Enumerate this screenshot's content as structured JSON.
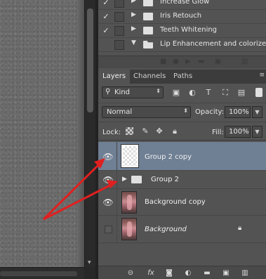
{
  "actions": {
    "items": [
      {
        "label": "Increase Glow",
        "checked": true,
        "expanded": false
      },
      {
        "label": "Iris Retouch",
        "checked": true,
        "expanded": false
      },
      {
        "label": "Teeth Whitening",
        "checked": true,
        "expanded": false
      },
      {
        "label": "Lip Enhancement and colorize",
        "checked": false,
        "expanded": true
      }
    ]
  },
  "tabs": [
    "Layers",
    "Channels",
    "Paths"
  ],
  "filter": {
    "kind_label": "Kind",
    "search_icon": "search-icon"
  },
  "blend": {
    "mode": "Normal",
    "opacity_label": "Opacity:",
    "opacity_value": "100%"
  },
  "lock": {
    "label": "Lock:",
    "fill_label": "Fill:",
    "fill_value": "100%"
  },
  "layers": [
    {
      "name": "Group 2 copy",
      "type": "transparent",
      "visible": true,
      "selected": true
    },
    {
      "name": "Group 2",
      "type": "group",
      "visible": true,
      "selected": false
    },
    {
      "name": "Background copy",
      "type": "photo",
      "visible": true,
      "selected": false
    },
    {
      "name": "Background",
      "type": "photo",
      "visible": false,
      "selected": false,
      "locked": true
    }
  ],
  "colors": {
    "selected_row": "#6f7f94",
    "panel": "#535353",
    "arrow": "#e02020"
  }
}
